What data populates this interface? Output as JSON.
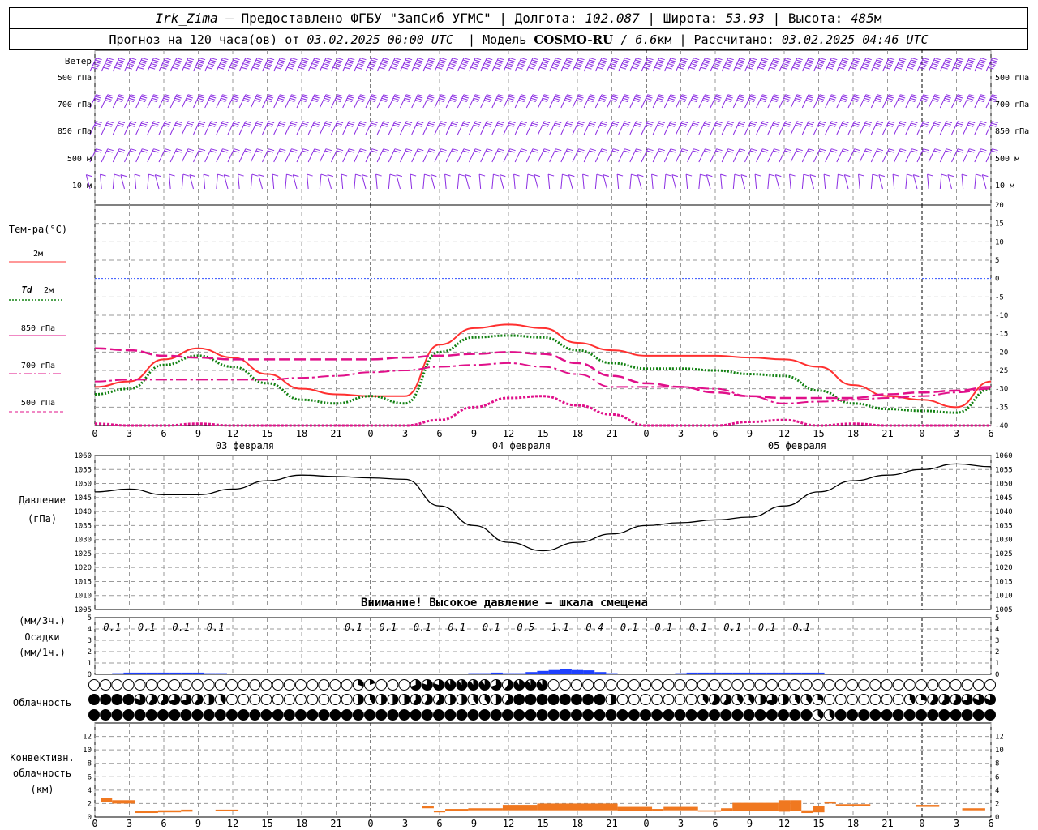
{
  "header": {
    "station": "Irk_Zima",
    "provider": "– Предоставлено ФГБУ \"ЗапСиб УГМС\"",
    "lon_label": "| Долгота:",
    "lon": "102.087",
    "lat_label": "| Широта:",
    "lat": "53.93",
    "alt_label": "| Высота:",
    "alt": "485",
    "alt_unit": "м",
    "forecast_label": "Прогноз на 120 часа(ов) от",
    "forecast_start": "03.02.2025 00:00 UTC",
    "model_label": "| Модель",
    "model": "COSMO-RU",
    "resolution": "/ 6.6",
    "resolution_unit": "км",
    "calc_label": "| Рассчитано:",
    "calc_time": "03.02.2025 04:46 UTC"
  },
  "wind_panel": {
    "title": "Ветер",
    "levels": [
      "500 гПа",
      "700 гПа",
      "850 гПа",
      "500 м",
      "10 м"
    ],
    "color": "#8a2be2"
  },
  "time_axis": {
    "hour_ticks": [
      "0",
      "3",
      "6",
      "9",
      "12",
      "15",
      "18",
      "21",
      "0",
      "3",
      "6",
      "9",
      "12",
      "15",
      "18",
      "21",
      "0",
      "3",
      "6",
      "9",
      "12",
      "15",
      "18",
      "21",
      "0",
      "3",
      "6"
    ],
    "days": [
      "03 февраля",
      "04 февраля",
      "05 февраля"
    ]
  },
  "legend": {
    "temp_title": "Тем-ра(°С)",
    "t2m": "2м",
    "td_symbol": "Td",
    "td_level": "2м",
    "t850": "850 гПа",
    "t700": "700 гПа",
    "t500": "500 гПа"
  },
  "pressure_labels": {
    "title": "Давление",
    "unit": "(гПа)",
    "warning": "Внимание! Высокое давление – шкала смещена"
  },
  "precip_labels": {
    "unit3": "(мм/3ч.)",
    "title": "Осадки",
    "unit1": "(мм/1ч.)"
  },
  "cloud_labels": {
    "title": "Облачность"
  },
  "conv_labels": {
    "title1": "Конвективн.",
    "title2": "облачность",
    "unit": "(км)"
  },
  "chart_data": [
    {
      "type": "line",
      "name": "temperature",
      "x": [
        0,
        3,
        6,
        9,
        12,
        15,
        18,
        21,
        24,
        27,
        30,
        33,
        36,
        39,
        42,
        45,
        48,
        51,
        54,
        57,
        60,
        63,
        66,
        69,
        72,
        75,
        78
      ],
      "ylim": [
        -40,
        20
      ],
      "yticks": [
        20,
        15,
        10,
        5,
        0,
        -5,
        -10,
        -15,
        -20,
        -25,
        -30,
        -35,
        -40
      ],
      "series": [
        {
          "name": "2м",
          "color": "#ff3030",
          "style": "solid",
          "values": [
            -29.5,
            -28,
            -22,
            -19,
            -21.5,
            -26,
            -30,
            -31.5,
            -32,
            -32,
            -18,
            -13.5,
            -12.5,
            -13.5,
            -17.5,
            -19.5,
            -21,
            -21,
            -21,
            -21.5,
            -22,
            -24,
            -29,
            -32,
            -33,
            -35,
            -28
          ]
        },
        {
          "name": "Td 2м",
          "color": "#108010",
          "style": "dotted",
          "values": [
            -31.5,
            -30,
            -23.5,
            -21,
            -24,
            -28.5,
            -33,
            -34,
            -32,
            -34,
            -20,
            -16,
            -15.5,
            -16,
            -19.5,
            -23,
            -24.5,
            -24.5,
            -25,
            -26,
            -26.5,
            -30.5,
            -34,
            -35.5,
            -36,
            -36.5,
            -30
          ]
        },
        {
          "name": "850 гПа",
          "color": "#e0108a",
          "style": "dashed",
          "values": [
            -19,
            -19.5,
            -21,
            -21.5,
            -22,
            -22,
            -22,
            -22,
            -22,
            -21.5,
            -21,
            -20.5,
            -20,
            -20.5,
            -23,
            -26.5,
            -28.5,
            -29.5,
            -31,
            -32,
            -32.5,
            -32.5,
            -32.5,
            -31.5,
            -31,
            -30.5,
            -29.5
          ]
        },
        {
          "name": "700 гПа",
          "color": "#e0108a",
          "style": "dashdot",
          "values": [
            -28,
            -27.5,
            -27.5,
            -27.5,
            -27.5,
            -27.5,
            -27,
            -26.5,
            -25.5,
            -25,
            -24,
            -23.5,
            -23,
            -24,
            -26,
            -29.5,
            -29.5,
            -29.5,
            -30,
            -32,
            -34,
            -33.5,
            -33,
            -32.5,
            -32,
            -31,
            -30
          ]
        },
        {
          "name": "500 гПа",
          "color": "#e0108a",
          "style": "finedot",
          "values": [
            -39.5,
            -41,
            -40,
            -39.5,
            -41,
            -41,
            -41,
            -41,
            -40,
            -40,
            -38.5,
            -35,
            -32.5,
            -32,
            -34.5,
            -37,
            -40,
            -41,
            -41,
            -39,
            -38.5,
            -40,
            -39.5,
            -41,
            -41,
            -41,
            -41
          ]
        }
      ]
    },
    {
      "type": "line",
      "name": "pressure",
      "x": [
        0,
        3,
        6,
        9,
        12,
        15,
        18,
        21,
        24,
        27,
        30,
        33,
        36,
        39,
        42,
        45,
        48,
        51,
        54,
        57,
        60,
        63,
        66,
        69,
        72,
        75,
        78
      ],
      "ylim": [
        1005,
        1060
      ],
      "yticks": [
        1060,
        1055,
        1050,
        1045,
        1040,
        1035,
        1030,
        1025,
        1020,
        1015,
        1010,
        1005
      ],
      "series": [
        {
          "name": "Давление",
          "color": "#000000",
          "values": [
            1047,
            1048,
            1046,
            1046,
            1048,
            1051,
            1053,
            1052.5,
            1052,
            1051.5,
            1042,
            1035,
            1029,
            1026,
            1029,
            1032,
            1035,
            1036,
            1037,
            1038,
            1042,
            1047,
            1051,
            1053,
            1055,
            1057,
            1056
          ]
        }
      ]
    },
    {
      "type": "bar",
      "name": "precipitation",
      "ylim": [
        0,
        5
      ],
      "yticks": [
        5,
        4,
        3,
        2,
        1,
        0
      ],
      "color": "#1e40ff",
      "hours": [
        1,
        2,
        3,
        4,
        5,
        6,
        7,
        8,
        9,
        10,
        11,
        12,
        13,
        14,
        15,
        16,
        17,
        18,
        19,
        20,
        21,
        22,
        23,
        24,
        25,
        26,
        27,
        28,
        29,
        30,
        31,
        32,
        33,
        34,
        35,
        36,
        37,
        38,
        39,
        40,
        41,
        42,
        43,
        44,
        45,
        46,
        47,
        48,
        49,
        50,
        51,
        52,
        53,
        54,
        55,
        56,
        57,
        58,
        59,
        60,
        61,
        62,
        63,
        64,
        65,
        66,
        67,
        68,
        69,
        70,
        71,
        72,
        73,
        74,
        75,
        76
      ],
      "values": [
        0.05,
        0.1,
        0.15,
        0.15,
        0.15,
        0.15,
        0.15,
        0.15,
        0.15,
        0.1,
        0.1,
        0.05,
        0.05,
        0,
        0,
        0,
        0,
        0,
        0,
        0.05,
        0,
        0,
        0,
        0.05,
        0.05,
        0.05,
        0,
        0.05,
        0.05,
        0,
        0.05,
        0.05,
        0.1,
        0.1,
        0.15,
        0.1,
        0.1,
        0.2,
        0.3,
        0.45,
        0.5,
        0.45,
        0.35,
        0.2,
        0.1,
        0.05,
        0.05,
        0,
        0,
        0.05,
        0.1,
        0.15,
        0.15,
        0.15,
        0.15,
        0.15,
        0.15,
        0.15,
        0.15,
        0.15,
        0.15,
        0.15,
        0.15,
        0,
        0,
        0,
        0,
        0,
        0.05,
        0,
        0,
        0.05,
        0.05,
        0,
        0.05,
        0
      ],
      "amounts_3h": [
        {
          "x": 1.5,
          "label": "0.1"
        },
        {
          "x": 4.5,
          "label": "0.1"
        },
        {
          "x": 7.5,
          "label": "0.1"
        },
        {
          "x": 10.5,
          "label": "0.1"
        },
        {
          "x": 22.5,
          "label": "0.1"
        },
        {
          "x": 25.5,
          "label": "0.1"
        },
        {
          "x": 28.5,
          "label": "0.1"
        },
        {
          "x": 31.5,
          "label": "0.1"
        },
        {
          "x": 34.5,
          "label": "0.1"
        },
        {
          "x": 37.5,
          "label": "0.5"
        },
        {
          "x": 40.5,
          "label": "1.1"
        },
        {
          "x": 43.5,
          "label": "0.4"
        },
        {
          "x": 46.5,
          "label": "0.1"
        },
        {
          "x": 49.5,
          "label": "0.1"
        },
        {
          "x": 52.5,
          "label": "0.1"
        },
        {
          "x": 55.5,
          "label": "0.1"
        },
        {
          "x": 58.5,
          "label": "0.1"
        },
        {
          "x": 61.5,
          "label": "0.1"
        }
      ]
    },
    {
      "type": "table",
      "name": "cloudiness",
      "note": "Hourly cloud cover octant fill (0=clear,1=overcast) for high, middle, low layers",
      "high": [
        0,
        0,
        0,
        0,
        0,
        0,
        0,
        0,
        0,
        0,
        0,
        0,
        0,
        0,
        0,
        0,
        0,
        0,
        0,
        0,
        0,
        0,
        0,
        0.3,
        0.2,
        0,
        0,
        0,
        0.7,
        0.8,
        0.8,
        0.9,
        0.9,
        0.9,
        0.9,
        0.7,
        0.6,
        0.9,
        0.9,
        0.9,
        0,
        0,
        0,
        0,
        0,
        0,
        0,
        0,
        0,
        0,
        0,
        0,
        0,
        0,
        0,
        0,
        0,
        0,
        0,
        0,
        0,
        0,
        0,
        0,
        0,
        0,
        0,
        0,
        0,
        0,
        0,
        0,
        0,
        0,
        0,
        0,
        0,
        0,
        0
      ],
      "middle": [
        1,
        1,
        1,
        1,
        0.8,
        0.6,
        0.6,
        0.7,
        0.7,
        0.6,
        0.5,
        0.4,
        0,
        0,
        0,
        0,
        0,
        0,
        0,
        0,
        0,
        0,
        0,
        0.5,
        0.4,
        0.5,
        0.5,
        0.5,
        0.6,
        0.6,
        0.6,
        0.5,
        0.5,
        0.4,
        0.4,
        0.5,
        0.6,
        1,
        1,
        1,
        1,
        1,
        1,
        1,
        1,
        0.5,
        0,
        0,
        0,
        0,
        0,
        0,
        0,
        0.4,
        0.6,
        0.6,
        0.4,
        0.4,
        0.5,
        0.7,
        0.5,
        0.4,
        0.4,
        0.3,
        0,
        0,
        0,
        0,
        0,
        0,
        0,
        0.4,
        0.3,
        0.6,
        0.6,
        0.6,
        0.7,
        0.8,
        0.8
      ],
      "low": [
        1,
        1,
        1,
        1,
        1,
        1,
        1,
        1,
        1,
        1,
        1,
        1,
        1,
        1,
        1,
        1,
        1,
        1,
        1,
        1,
        1,
        1,
        1,
        1,
        1,
        1,
        1,
        1,
        1,
        1,
        1,
        1,
        1,
        1,
        1,
        1,
        1,
        1,
        1,
        1,
        1,
        1,
        1,
        1,
        1,
        1,
        1,
        1,
        1,
        1,
        1,
        1,
        1,
        1,
        1,
        1,
        1,
        1,
        1,
        1,
        1,
        1,
        1,
        0.4,
        0.4,
        1,
        1,
        1,
        1,
        1,
        1,
        1,
        1,
        1,
        1,
        1,
        1,
        1,
        1
      ]
    },
    {
      "type": "bar",
      "name": "convective_cloud",
      "ylim": [
        0,
        14
      ],
      "yticks": [
        12,
        10,
        8,
        6,
        4,
        2,
        0
      ],
      "color": "#f07820",
      "segments": [
        {
          "x0": 0.5,
          "x1": 1.5,
          "top": 2.8,
          "base": 2.2
        },
        {
          "x0": 1.5,
          "x1": 3.5,
          "top": 2.5,
          "base": 2.0
        },
        {
          "x0": 3.5,
          "x1": 5.5,
          "top": 0.9,
          "base": 0.6
        },
        {
          "x0": 5.5,
          "x1": 7.5,
          "top": 1.0,
          "base": 0.7
        },
        {
          "x0": 7.5,
          "x1": 8.5,
          "top": 1.1,
          "base": 0.8
        },
        {
          "x0": 10.5,
          "x1": 12.5,
          "top": 1.1,
          "base": 0.9
        },
        {
          "x0": 28.5,
          "x1": 29.5,
          "top": 1.6,
          "base": 1.3
        },
        {
          "x0": 29.5,
          "x1": 30.5,
          "top": 0.9,
          "base": 0.7
        },
        {
          "x0": 30.5,
          "x1": 32.5,
          "top": 1.2,
          "base": 0.9
        },
        {
          "x0": 32.5,
          "x1": 35.5,
          "top": 1.3,
          "base": 1.0
        },
        {
          "x0": 35.5,
          "x1": 38.5,
          "top": 1.8,
          "base": 1.0
        },
        {
          "x0": 38.5,
          "x1": 45.5,
          "top": 2.0,
          "base": 1.0
        },
        {
          "x0": 45.5,
          "x1": 48.5,
          "top": 1.5,
          "base": 0.9
        },
        {
          "x0": 48.5,
          "x1": 49.5,
          "top": 1.2,
          "base": 0.9
        },
        {
          "x0": 49.5,
          "x1": 52.5,
          "top": 1.5,
          "base": 1.0
        },
        {
          "x0": 52.5,
          "x1": 54.5,
          "top": 1.0,
          "base": 0.8
        },
        {
          "x0": 54.5,
          "x1": 55.5,
          "top": 1.3,
          "base": 0.9
        },
        {
          "x0": 55.5,
          "x1": 59.5,
          "top": 2.1,
          "base": 0.9
        },
        {
          "x0": 59.5,
          "x1": 60.5,
          "top": 2.5,
          "base": 0.8
        },
        {
          "x0": 60.5,
          "x1": 61.5,
          "top": 2.5,
          "base": 0.9
        },
        {
          "x0": 61.5,
          "x1": 62.5,
          "top": 1.0,
          "base": 0.6
        },
        {
          "x0": 62.5,
          "x1": 63.5,
          "top": 1.6,
          "base": 0.7
        },
        {
          "x0": 63.5,
          "x1": 64.5,
          "top": 2.3,
          "base": 2.0
        },
        {
          "x0": 64.5,
          "x1": 67.5,
          "top": 1.9,
          "base": 1.6
        },
        {
          "x0": 71.5,
          "x1": 73.5,
          "top": 1.8,
          "base": 1.5
        },
        {
          "x0": 75.5,
          "x1": 77.5,
          "top": 1.3,
          "base": 1.0
        }
      ]
    }
  ]
}
